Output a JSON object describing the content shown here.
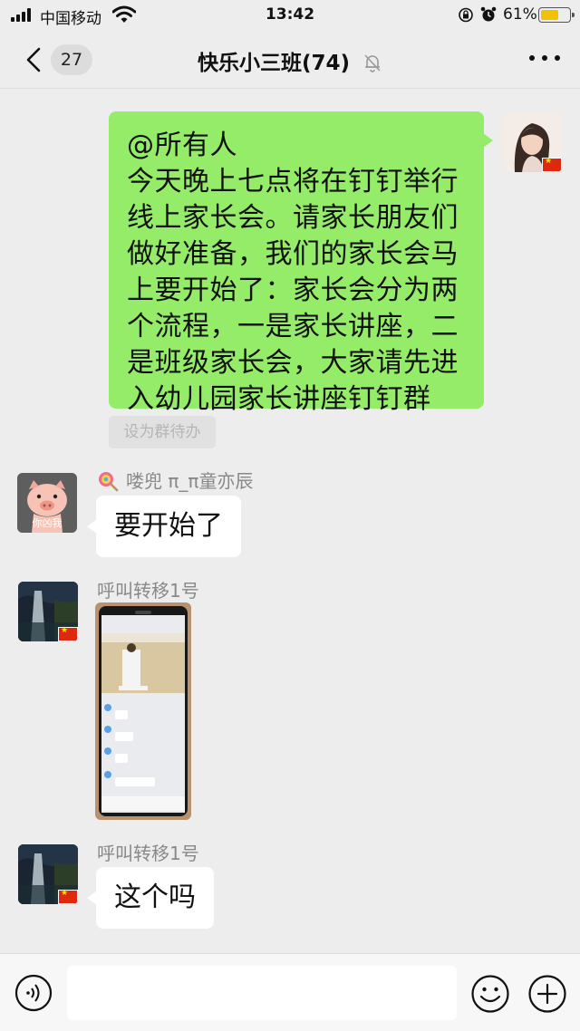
{
  "status_bar": {
    "carrier": "中国移动",
    "time": "13:42",
    "battery_percent": "61%",
    "battery_level": 0.61,
    "icons": [
      "signal-icon",
      "wifi-icon",
      "orientation-lock-icon",
      "alarm-icon",
      "battery-icon"
    ]
  },
  "nav": {
    "unread_count": "27",
    "title": "快乐小三班(74)",
    "icons": [
      "back-chevron-icon",
      "mute-bell-icon",
      "more-icon"
    ]
  },
  "messages": [
    {
      "side": "right",
      "lines": [
        "@所有人",
        "今天晚上七点将在钉钉举行",
        "线上家长会。请家长朋友们",
        "做好准备，我们的家长会马",
        "上要开始了：家长会分为两",
        "个流程，一是家长讲座，二",
        "是班级家长会，大家请先进",
        "入幼儿园家长讲座钉钉群"
      ],
      "tag": "设为群待办"
    },
    {
      "side": "left",
      "sender": "喽兜 π_π童亦辰",
      "text": "要开始了",
      "avatar_caption": "你凶我"
    },
    {
      "side": "left",
      "sender": "呼叫转移1号",
      "type": "image"
    },
    {
      "side": "left",
      "sender": "呼叫转移1号",
      "text": "这个吗"
    }
  ],
  "input_bar": {
    "placeholder": "",
    "icons": [
      "voice-icon",
      "emoji-icon",
      "plus-icon"
    ]
  },
  "colors": {
    "background": "#ededed",
    "bubble_self": "#95ec69",
    "bubble_other": "#ffffff"
  }
}
